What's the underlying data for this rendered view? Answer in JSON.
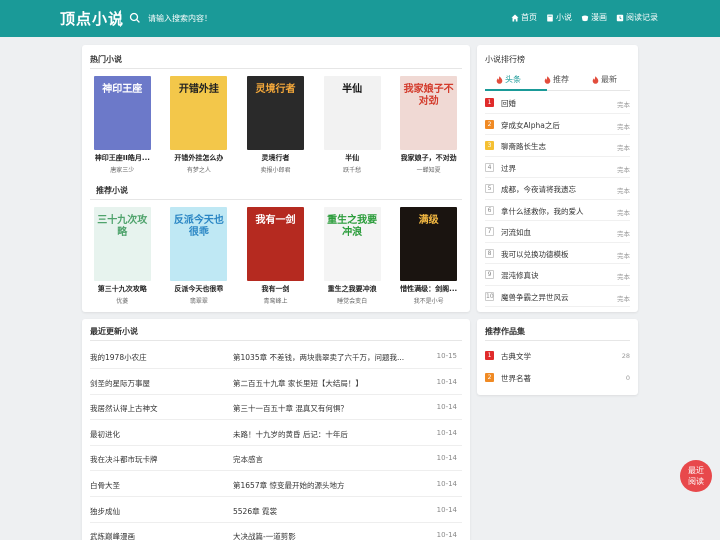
{
  "header": {
    "logo": "顶点小说",
    "search_placeholder": "请输入搜索内容！",
    "nav": [
      {
        "label": "首页",
        "icon": "home-icon"
      },
      {
        "label": "小说",
        "icon": "book-icon"
      },
      {
        "label": "漫画",
        "icon": "cup-icon"
      },
      {
        "label": "阅读记录",
        "icon": "history-icon"
      }
    ]
  },
  "hot": {
    "title": "热门小说",
    "books": [
      {
        "title": "神印王座II皓月...",
        "author": "唐家三少",
        "cover_text": "神印王座",
        "cover_bg": "#6c79c9",
        "cover_fg": "#ffffff"
      },
      {
        "title": "开错外挂怎么办",
        "author": "有梦之人",
        "cover_text": "开错外挂",
        "cover_bg": "#f3c74a",
        "cover_fg": "#222222"
      },
      {
        "title": "灵境行者",
        "author": "卖报小郎君",
        "cover_text": "灵境行者",
        "cover_bg": "#2a2a2a",
        "cover_fg": "#f4a83a"
      },
      {
        "title": "半仙",
        "author": "跃千愁",
        "cover_text": "半仙",
        "cover_bg": "#f2f2f2",
        "cover_fg": "#111111"
      },
      {
        "title": "我家娘子，不对劲",
        "author": "一蝉知夏",
        "cover_text": "我家娘子不对劲",
        "cover_bg": "#f0d9d4",
        "cover_fg": "#d33b2c"
      }
    ]
  },
  "recommend": {
    "title": "推荐小说",
    "books": [
      {
        "title": "第三十九次攻略",
        "author": "优菱",
        "cover_text": "三十九次攻略",
        "cover_bg": "#e7f3ee",
        "cover_fg": "#4fa36c"
      },
      {
        "title": "反派今天也很乖",
        "author": "翡翠翠",
        "cover_text": "反派今天也很乖",
        "cover_bg": "#bfe8f4",
        "cover_fg": "#2a86c4"
      },
      {
        "title": "我有一剑",
        "author": "青鸾峰上",
        "cover_text": "我有一剑",
        "cover_bg": "#b52a20",
        "cover_fg": "#ffffff"
      },
      {
        "title": "重生之我要冲浪",
        "author": "睡觉会变白",
        "cover_text": "重生之我要冲浪",
        "cover_bg": "#f4f4f4",
        "cover_fg": "#2a9c3a"
      },
      {
        "title": "惜性满级：剑阁...",
        "author": "我不是小号",
        "cover_text": "满级",
        "cover_bg": "#1a1410",
        "cover_fg": "#f4b942"
      }
    ]
  },
  "updates": {
    "title": "最近更新小说",
    "rows": [
      {
        "name": "我的1978小农庄",
        "chapter": "第1035章 不差钱，两块翡翠卖了六千万，问题我...",
        "date": "10-15"
      },
      {
        "name": "剑圣的星际万事屋",
        "chapter": "第二百五十九章 家长里短【大结局！】",
        "date": "10-14"
      },
      {
        "name": "我居然认得上古神文",
        "chapter": "第三十一百五十章 混真又有何惧？",
        "date": "10-14"
      },
      {
        "name": "最初进化",
        "chapter": "未路！十九岁的黄昏 后记：十年后",
        "date": "10-14"
      },
      {
        "name": "我在决斗都市玩卡牌",
        "chapter": "完本感言",
        "date": "10-14"
      },
      {
        "name": "白骨大圣",
        "chapter": "第1657章 惊变最开始的源头地方",
        "date": "10-14"
      },
      {
        "name": "独步成仙",
        "chapter": "5526章 霓裳",
        "date": "10-14"
      },
      {
        "name": "武炼巅峰漫画",
        "chapter": "大决战篇-一道剪影",
        "date": "10-14"
      }
    ]
  },
  "rank": {
    "title": "小说排行榜",
    "tabs": [
      "头条",
      "推荐",
      "最新"
    ],
    "items": [
      {
        "num": "1",
        "name": "回婚",
        "status": "完本",
        "color": "#e02b2b"
      },
      {
        "num": "2",
        "name": "穿成女Alpha之后",
        "status": "完本",
        "color": "#f08a24"
      },
      {
        "num": "3",
        "name": "聊斋路长生志",
        "status": "完本",
        "color": "#f5c033"
      },
      {
        "num": "4",
        "name": "过界",
        "status": "完本",
        "color": "#bbbbbb"
      },
      {
        "num": "5",
        "name": "成都，今夜请将我遗忘",
        "status": "完本",
        "color": "#bbbbbb"
      },
      {
        "num": "6",
        "name": "拿什么拯救你，我的爱人",
        "status": "完本",
        "color": "#bbbbbb"
      },
      {
        "num": "7",
        "name": "河流如血",
        "status": "完本",
        "color": "#bbbbbb"
      },
      {
        "num": "8",
        "name": "我可以兑换功德模板",
        "status": "完本",
        "color": "#bbbbbb"
      },
      {
        "num": "9",
        "name": "混沌修真诀",
        "status": "完本",
        "color": "#bbbbbb"
      },
      {
        "num": "10",
        "name": "魔兽争霸之异世风云",
        "status": "完本",
        "color": "#bbbbbb"
      }
    ]
  },
  "collections": {
    "title": "推荐作品集",
    "items": [
      {
        "num": "1",
        "name": "古典文学",
        "count": "28",
        "color": "#e02b2b"
      },
      {
        "num": "2",
        "name": "世界名著",
        "count": "0",
        "color": "#f08a24"
      }
    ]
  },
  "float_button": {
    "line1": "最近",
    "line2": "阅读"
  },
  "colors": {
    "header": "#1a9a98",
    "accent": "#1a9a98",
    "float": "#e8484b"
  }
}
